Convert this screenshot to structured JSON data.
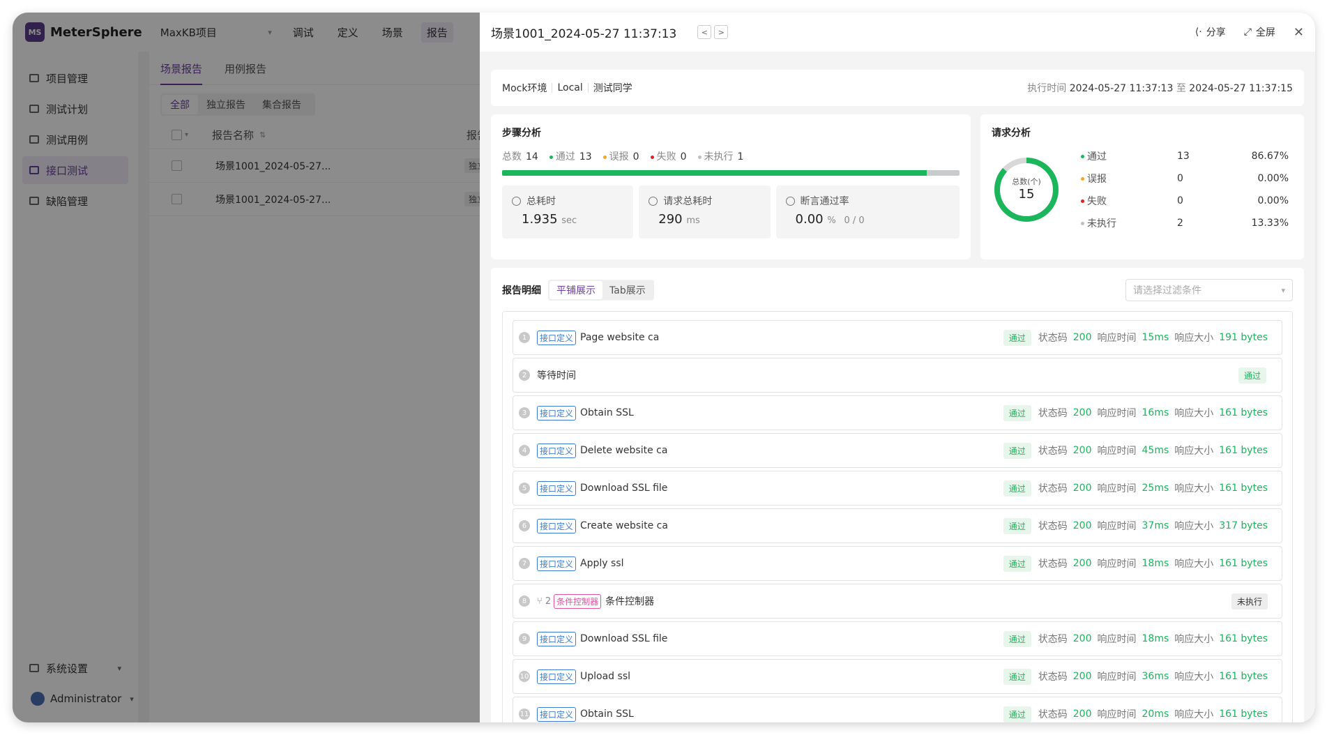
{
  "app": {
    "name": "MeterSphere",
    "logo_mark": "MS",
    "project": "MaxKB项目",
    "top_nav": [
      "调试",
      "定义",
      "场景",
      "报告"
    ],
    "active_nav": "报告"
  },
  "sidebar": {
    "items": [
      {
        "label": "项目管理",
        "icon": "project-icon"
      },
      {
        "label": "测试计划",
        "icon": "plan-icon"
      },
      {
        "label": "测试用例",
        "icon": "case-icon"
      },
      {
        "label": "接口测试",
        "icon": "api-icon"
      },
      {
        "label": "缺陷管理",
        "icon": "bug-icon"
      }
    ],
    "settings": "系统设置",
    "user": "Administrator"
  },
  "report_list": {
    "tabs": [
      "场景报告",
      "用例报告"
    ],
    "filters": [
      "全部",
      "独立报告",
      "集合报告"
    ],
    "col_name": "报告名称",
    "col_type": "报告类",
    "rows": [
      {
        "name": "场景1001_2024-05-27...",
        "type": "独立报"
      },
      {
        "name": "场景1001_2024-05-27...",
        "type": "独立报"
      }
    ]
  },
  "drawer": {
    "title": "场景1001_2024-05-27 11:37:13",
    "share": "分享",
    "fullscreen": "全屏",
    "env": [
      "Mock环境",
      "Local",
      "测试同学"
    ],
    "exec_label": "执行时间",
    "exec_start": "2024-05-27 11:37:13",
    "exec_to": "至",
    "exec_end": "2024-05-27 11:37:15"
  },
  "steps": {
    "title": "步骤分析",
    "total_label": "总数",
    "total": "14",
    "pass_label": "通过",
    "pass": "13",
    "false_label": "误报",
    "false": "0",
    "fail_label": "失败",
    "fail": "0",
    "unexec_label": "未执行",
    "unexec": "1",
    "progress_fraction": 0.9285,
    "total_time_label": "总耗时",
    "total_time": "1.935",
    "total_time_unit": "sec",
    "req_time_label": "请求总耗时",
    "req_time": "290",
    "req_time_unit": "ms",
    "assert_label": "断言通过率",
    "assert_rate": "0.00",
    "assert_unit": "%",
    "assert_ratio": "0 / 0"
  },
  "request": {
    "title": "请求分析",
    "ring_label": "总数(个)",
    "ring_total": "15",
    "pass_fraction": 0.8667,
    "rows": [
      {
        "label": "通过",
        "count": "13",
        "pct": "86.67%",
        "color": "#1bb55c"
      },
      {
        "label": "误报",
        "count": "0",
        "pct": "0.00%",
        "color": "#f5a623"
      },
      {
        "label": "失败",
        "count": "0",
        "pct": "0.00%",
        "color": "#e02020"
      },
      {
        "label": "未执行",
        "count": "2",
        "pct": "13.33%",
        "color": "#c0c0c0"
      }
    ]
  },
  "detail": {
    "title": "报告明细",
    "views": [
      "平铺展示",
      "Tab展示"
    ],
    "filter_placeholder": "请选择过滤条件",
    "code_label": "状态码",
    "time_label": "响应时间",
    "size_label": "响应大小",
    "rows": [
      {
        "num": "1",
        "tag": "接口定义",
        "name": "Page website ca",
        "status": "通过",
        "code": "200",
        "time": "15ms",
        "size": "191 bytes"
      },
      {
        "num": "2",
        "tag": "",
        "name": "等待时间",
        "status": "通过",
        "code": "",
        "time": "",
        "size": ""
      },
      {
        "num": "3",
        "tag": "接口定义",
        "name": "Obtain SSL",
        "status": "通过",
        "code": "200",
        "time": "16ms",
        "size": "161 bytes"
      },
      {
        "num": "4",
        "tag": "接口定义",
        "name": "Delete website ca",
        "status": "通过",
        "code": "200",
        "time": "45ms",
        "size": "161 bytes"
      },
      {
        "num": "5",
        "tag": "接口定义",
        "name": "Download SSL file",
        "status": "通过",
        "code": "200",
        "time": "25ms",
        "size": "161 bytes"
      },
      {
        "num": "6",
        "tag": "接口定义",
        "name": "Create website ca",
        "status": "通过",
        "code": "200",
        "time": "37ms",
        "size": "317 bytes"
      },
      {
        "num": "7",
        "tag": "接口定义",
        "name": "Apply ssl",
        "status": "通过",
        "code": "200",
        "time": "18ms",
        "size": "161 bytes"
      },
      {
        "num": "8",
        "tag": "条件控制器",
        "branch": "2",
        "name": "条件控制器",
        "status": "未执行",
        "code": "",
        "time": "",
        "size": ""
      },
      {
        "num": "9",
        "tag": "接口定义",
        "name": "Download SSL file",
        "status": "通过",
        "code": "200",
        "time": "18ms",
        "size": "161 bytes"
      },
      {
        "num": "10",
        "tag": "接口定义",
        "name": "Upload ssl",
        "status": "通过",
        "code": "200",
        "time": "36ms",
        "size": "161 bytes"
      },
      {
        "num": "11",
        "tag": "接口定义",
        "name": "Obtain SSL",
        "status": "通过",
        "code": "200",
        "time": "20ms",
        "size": "161 bytes"
      }
    ]
  }
}
